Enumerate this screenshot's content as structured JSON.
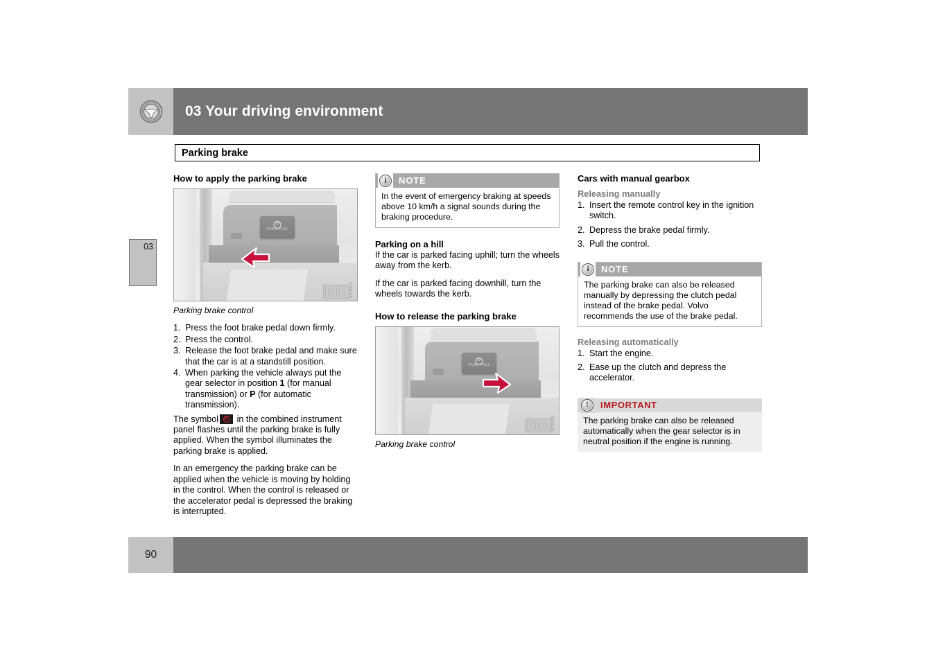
{
  "header": {
    "chapter_title": "03 Your driving environment",
    "logo_icon": "steering-wheel-icon"
  },
  "section": {
    "title": "Parking brake"
  },
  "chapter_tab": {
    "number": "03"
  },
  "footer": {
    "page_number": "90"
  },
  "left_column": {
    "heading": "How to apply the parking brake",
    "figure": {
      "caption": "Parking brake control",
      "watermark": "5500130",
      "switch_label": "PUSH PULL",
      "switch_symbol": "parking-brake-symbol"
    },
    "steps": [
      {
        "num": "1.",
        "text": "Press the foot brake pedal down firmly."
      },
      {
        "num": "2.",
        "text": "Press the control."
      },
      {
        "num": "3.",
        "text": "Release the foot brake pedal and make sure that the car is at a standstill position."
      }
    ],
    "step4": {
      "num": "4.",
      "part1": "When parking the vehicle always put the gear selector in position ",
      "bold1": "1",
      "part2": " (for manual transmission) or ",
      "bold2": "P",
      "part3": " (for automatic transmission)."
    },
    "para_symbol": {
      "before": "The symbol",
      "after": "in the combined instrument panel flashes until the parking brake is fully applied. When the symbol illuminates the parking brake is applied."
    },
    "para_emergency": "In an emergency the parking brake can be applied when the vehicle is moving by holding in the control. When the control is released or the accelerator pedal is depressed the braking is interrupted."
  },
  "mid_column": {
    "note": {
      "title": "NOTE",
      "icon": "info-icon",
      "body": "In the event of emergency braking at speeds above 10 km/h a signal sounds during the braking procedure."
    },
    "hill_heading": "Parking on a hill",
    "hill_para1": "If the car is parked facing uphill; turn the wheels away from the kerb.",
    "hill_para2": "If the car is parked facing downhill, turn the wheels towards the kerb.",
    "release_heading": "How to release the parking brake",
    "figure": {
      "caption": "Parking brake control",
      "watermark": "5500132",
      "switch_label": "PUSH PULL",
      "switch_symbol": "parking-brake-symbol"
    }
  },
  "right_column": {
    "heading": "Cars with manual gearbox",
    "manual_subhead": "Releasing manually",
    "manual_steps": [
      {
        "num": "1.",
        "text": "Insert the remote control key in the ignition switch."
      },
      {
        "num": "2.",
        "text": "Depress the brake pedal firmly."
      },
      {
        "num": "3.",
        "text": "Pull the control."
      }
    ],
    "note": {
      "title": "NOTE",
      "icon": "info-icon",
      "body": "The parking brake can also be released manually by depressing the clutch pedal instead of the brake pedal. Volvo recommends the use of the brake pedal."
    },
    "auto_subhead": "Releasing automatically",
    "auto_steps": [
      {
        "num": "1.",
        "text": "Start the engine."
      },
      {
        "num": "2.",
        "text": "Ease up the clutch and depress the accelerator."
      }
    ],
    "important": {
      "title": "IMPORTANT",
      "icon": "exclamation-icon",
      "body": "The parking brake can also be released automatically when the gear selector is in neutral position if the engine is running."
    }
  },
  "colors": {
    "band_gray": "#757575",
    "tab_gray": "#c2c2c2",
    "note_head_gray": "#a8a8a8",
    "important_head_gray": "#d8d8d8",
    "important_red": "#b81c20",
    "subhead_gray": "#7c7c7c",
    "arrow_red": "#c8103c"
  }
}
